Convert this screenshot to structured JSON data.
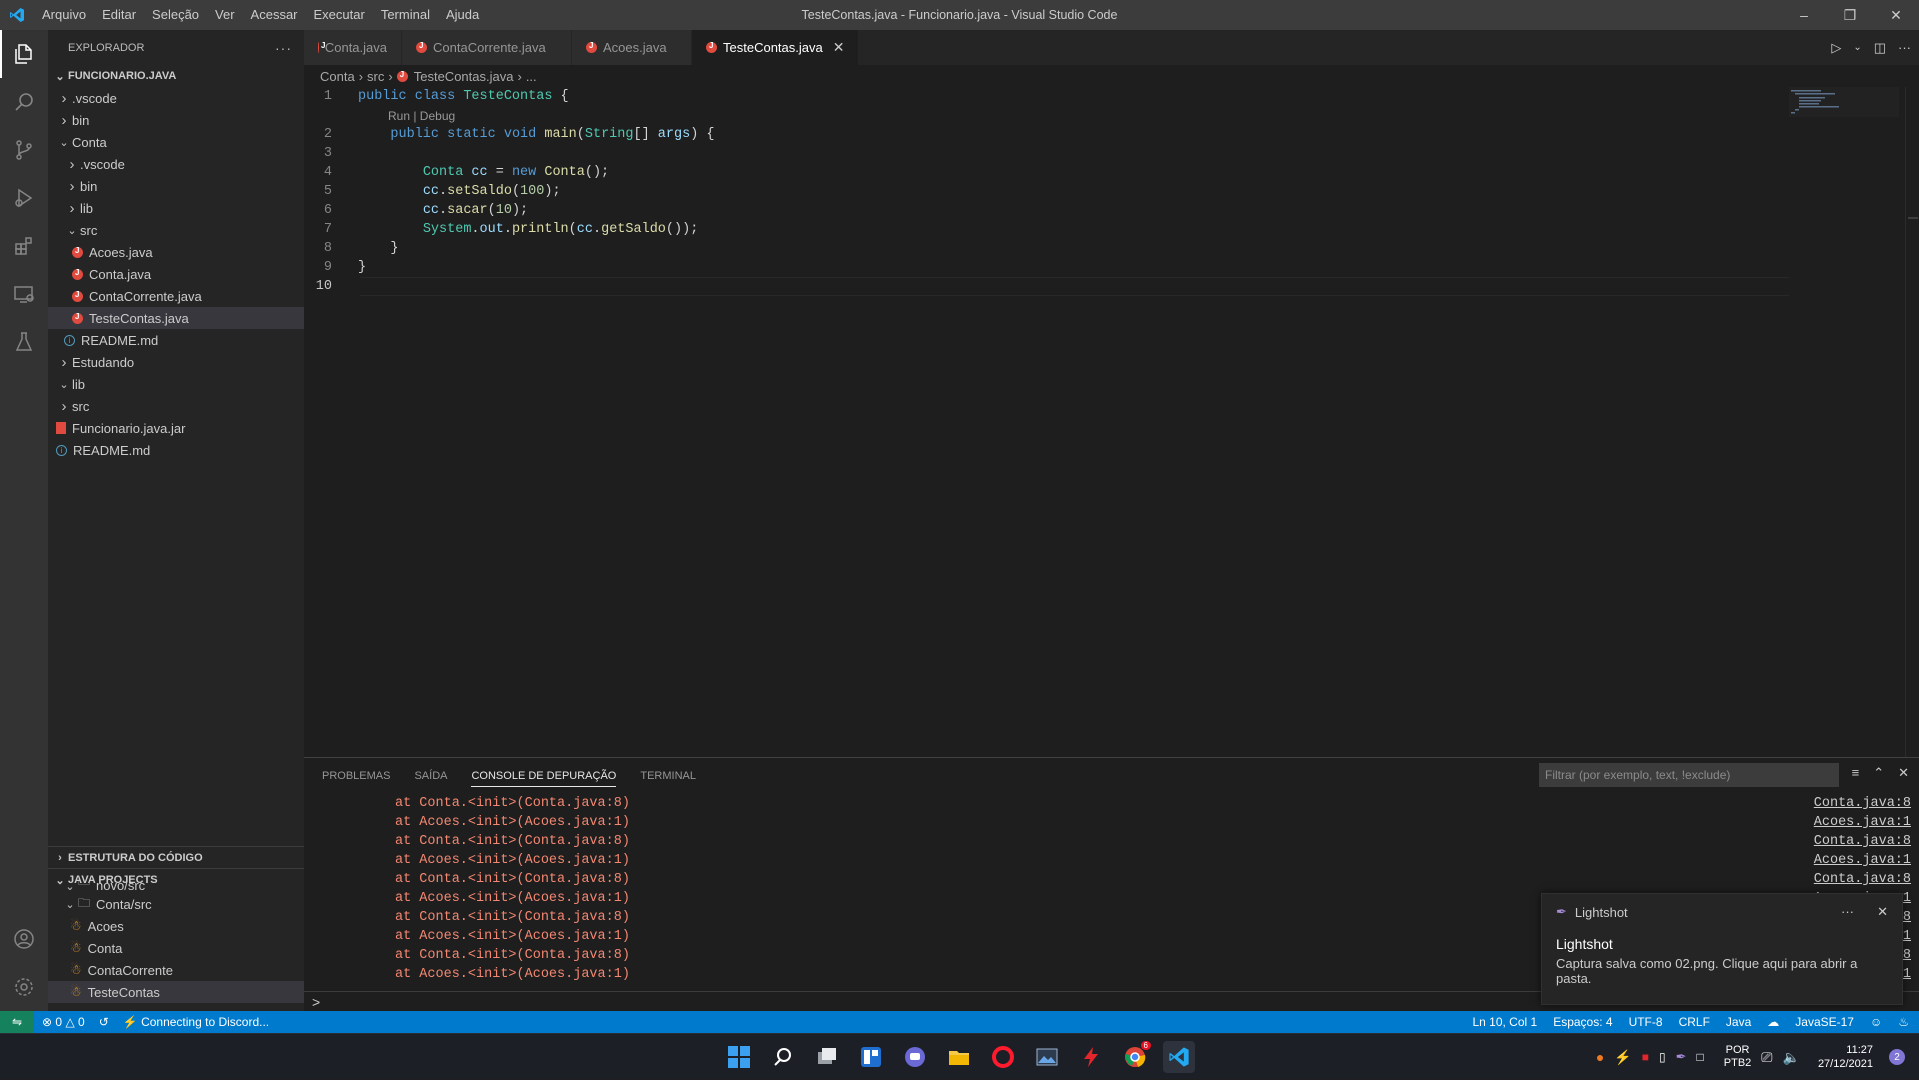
{
  "titlebar": {
    "menu": [
      "Arquivo",
      "Editar",
      "Seleção",
      "Ver",
      "Acessar",
      "Executar",
      "Terminal",
      "Ajuda"
    ],
    "title": "TesteContas.java - Funcionario.java - Visual Studio Code"
  },
  "sidebar": {
    "header": "EXPLORADOR",
    "root": "FUNCIONARIO.JAVA",
    "tree": [
      {
        "label": ".vscode",
        "depth": 1,
        "kind": "folder-closed"
      },
      {
        "label": "bin",
        "depth": 1,
        "kind": "folder-closed"
      },
      {
        "label": "Conta",
        "depth": 1,
        "kind": "folder-open"
      },
      {
        "label": ".vscode",
        "depth": 2,
        "kind": "folder-closed"
      },
      {
        "label": "bin",
        "depth": 2,
        "kind": "folder-closed"
      },
      {
        "label": "lib",
        "depth": 2,
        "kind": "folder-closed"
      },
      {
        "label": "src",
        "depth": 2,
        "kind": "folder-open"
      },
      {
        "label": "Acoes.java",
        "depth": 3,
        "kind": "java"
      },
      {
        "label": "Conta.java",
        "depth": 3,
        "kind": "java"
      },
      {
        "label": "ContaCorrente.java",
        "depth": 3,
        "kind": "java"
      },
      {
        "label": "TesteContas.java",
        "depth": 3,
        "kind": "java",
        "selected": true
      },
      {
        "label": "README.md",
        "depth": 2,
        "kind": "info"
      },
      {
        "label": "Estudando",
        "depth": 1,
        "kind": "folder-closed"
      },
      {
        "label": "lib",
        "depth": 1,
        "kind": "folder-open"
      },
      {
        "label": "src",
        "depth": 1,
        "kind": "folder-closed"
      },
      {
        "label": "Funcionario.java.jar",
        "depth": 1,
        "kind": "jar"
      },
      {
        "label": "README.md",
        "depth": 1,
        "kind": "info"
      }
    ],
    "outline": "ESTRUTURA DO CÓDIGO",
    "java_projects": "JAVA PROJECTS",
    "projects": [
      {
        "label": "novo/src",
        "depth": 1,
        "kind": "pkg-cut"
      },
      {
        "label": "Conta/src",
        "depth": 1,
        "kind": "pkg"
      },
      {
        "label": "Acoes",
        "depth": 2,
        "kind": "class"
      },
      {
        "label": "Conta",
        "depth": 2,
        "kind": "class"
      },
      {
        "label": "ContaCorrente",
        "depth": 2,
        "kind": "class"
      },
      {
        "label": "TesteContas",
        "depth": 2,
        "kind": "class",
        "selected": true
      }
    ]
  },
  "tabs": [
    {
      "label": "Conta.java",
      "active": false
    },
    {
      "label": "ContaCorrente.java",
      "active": false
    },
    {
      "label": "Acoes.java",
      "active": false
    },
    {
      "label": "TesteContas.java",
      "active": true
    }
  ],
  "breadcrumb": [
    "Conta",
    "src",
    "TesteContas.java",
    "..."
  ],
  "code": {
    "lens": "Run | Debug",
    "lines": [
      {
        "n": "1",
        "tokens": [
          [
            "kw",
            "public "
          ],
          [
            "kw",
            "class "
          ],
          [
            "ty",
            "TesteContas"
          ],
          [
            "pl",
            " {"
          ]
        ]
      },
      {
        "n": "2",
        "tokens": [
          [
            "pl",
            "    "
          ],
          [
            "kw",
            "public "
          ],
          [
            "kw",
            "static "
          ],
          [
            "kw",
            "void "
          ],
          [
            "fn",
            "main"
          ],
          [
            "pl",
            "("
          ],
          [
            "ty",
            "String"
          ],
          [
            "pl",
            "[] "
          ],
          [
            "vr",
            "args"
          ],
          [
            "pl",
            ") {"
          ]
        ]
      },
      {
        "n": "3",
        "tokens": []
      },
      {
        "n": "4",
        "tokens": [
          [
            "pl",
            "        "
          ],
          [
            "ty",
            "Conta "
          ],
          [
            "vr",
            "cc"
          ],
          [
            "pl",
            " = "
          ],
          [
            "kw",
            "new "
          ],
          [
            "fn",
            "Conta"
          ],
          [
            "pl",
            "();"
          ]
        ]
      },
      {
        "n": "5",
        "tokens": [
          [
            "pl",
            "        "
          ],
          [
            "vr",
            "cc"
          ],
          [
            "pl",
            "."
          ],
          [
            "fn",
            "setSaldo"
          ],
          [
            "pl",
            "("
          ],
          [
            "nm",
            "100"
          ],
          [
            "pl",
            ");"
          ]
        ]
      },
      {
        "n": "6",
        "tokens": [
          [
            "pl",
            "        "
          ],
          [
            "vr",
            "cc"
          ],
          [
            "pl",
            "."
          ],
          [
            "fn",
            "sacar"
          ],
          [
            "pl",
            "("
          ],
          [
            "nm",
            "10"
          ],
          [
            "pl",
            ");"
          ]
        ]
      },
      {
        "n": "7",
        "tokens": [
          [
            "pl",
            "        "
          ],
          [
            "ty",
            "System"
          ],
          [
            "pl",
            "."
          ],
          [
            "vr",
            "out"
          ],
          [
            "pl",
            "."
          ],
          [
            "fn",
            "println"
          ],
          [
            "pl",
            "("
          ],
          [
            "vr",
            "cc"
          ],
          [
            "pl",
            "."
          ],
          [
            "fn",
            "getSaldo"
          ],
          [
            "pl",
            "());"
          ]
        ]
      },
      {
        "n": "8",
        "tokens": [
          [
            "pl",
            "    }"
          ]
        ]
      },
      {
        "n": "9",
        "tokens": [
          [
            "pl",
            "}"
          ]
        ]
      },
      {
        "n": "10",
        "tokens": [],
        "current": true
      }
    ]
  },
  "panel": {
    "tabs": [
      "PROBLEMAS",
      "SAÍDA",
      "CONSOLE DE DEPURAÇÃO",
      "TERMINAL"
    ],
    "active_tab": "CONSOLE DE DEPURAÇÃO",
    "filter_placeholder": "Filtrar (por exemplo, text, !exclude)",
    "console": [
      {
        "msg": "at Conta.<init>(Conta.java:8)",
        "link": "Conta.java:8"
      },
      {
        "msg": "at Acoes.<init>(Acoes.java:1)",
        "link": "Acoes.java:1"
      },
      {
        "msg": "at Conta.<init>(Conta.java:8)",
        "link": "Conta.java:8"
      },
      {
        "msg": "at Acoes.<init>(Acoes.java:1)",
        "link": "Acoes.java:1"
      },
      {
        "msg": "at Conta.<init>(Conta.java:8)",
        "link": "Conta.java:8"
      },
      {
        "msg": "at Acoes.<init>(Acoes.java:1)",
        "link": "Acoes.java:1"
      },
      {
        "msg": "at Conta.<init>(Conta.java:8)",
        "link": "Conta.java:8"
      },
      {
        "msg": "at Acoes.<init>(Acoes.java:1)",
        "link": "Acoes.java:1"
      },
      {
        "msg": "at Conta.<init>(Conta.java:8)",
        "link": "Conta.java:8"
      },
      {
        "msg": "at Acoes.<init>(Acoes.java:1)",
        "link": "Acoes.java:1"
      }
    ],
    "prompt": ">"
  },
  "notification": {
    "source": "Lightshot",
    "title": "Lightshot",
    "body": "Captura salva como 02.png. Clique aqui para abrir a pasta."
  },
  "statusbar": {
    "errors": "0",
    "warnings": "0",
    "discord": "Connecting to Discord...",
    "position": "Ln 10, Col 1",
    "spaces": "Espaços: 4",
    "encoding": "UTF-8",
    "eol": "CRLF",
    "language": "Java",
    "runtime": "JavaSE-17"
  },
  "taskbar": {
    "lang": "POR",
    "layout": "PTB2",
    "time": "11:27",
    "date": "27/12/2021",
    "notif_count": "2",
    "chrome_badge": "6"
  },
  "colors": {
    "accent": "#007acc",
    "remote": "#16825d",
    "error_text": "#f48771",
    "java_icon": "#e04a3f"
  }
}
